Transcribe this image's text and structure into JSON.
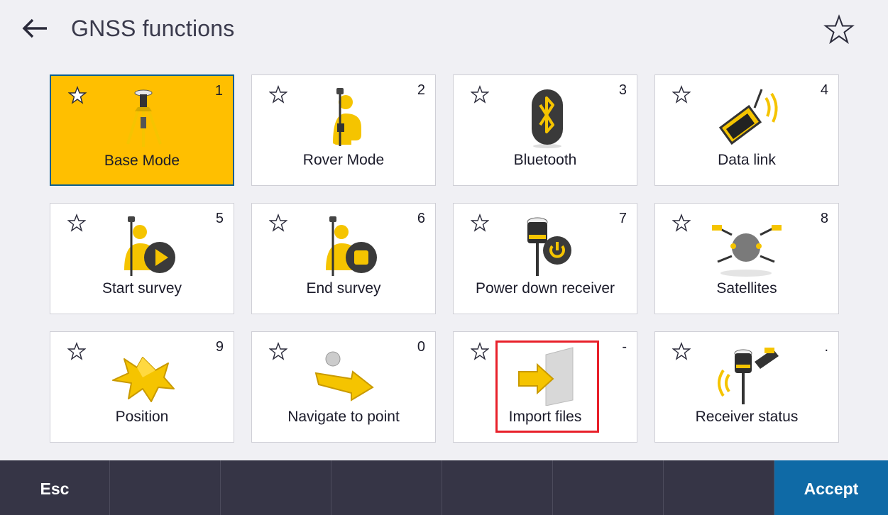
{
  "header": {
    "title": "GNSS functions",
    "back_icon": "arrow-left-icon",
    "favorite_icon": "star-outline-icon"
  },
  "tiles": [
    {
      "label": "Base Mode",
      "key": "1",
      "icon": "tripod-base-icon",
      "selected": true
    },
    {
      "label": "Rover Mode",
      "key": "2",
      "icon": "rover-person-icon",
      "selected": false
    },
    {
      "label": "Bluetooth",
      "key": "3",
      "icon": "bluetooth-icon",
      "selected": false
    },
    {
      "label": "Data link",
      "key": "4",
      "icon": "radio-data-link-icon",
      "selected": false
    },
    {
      "label": "Start survey",
      "key": "5",
      "icon": "start-survey-icon",
      "selected": false
    },
    {
      "label": "End survey",
      "key": "6",
      "icon": "end-survey-icon",
      "selected": false
    },
    {
      "label": "Power down receiver",
      "key": "7",
      "icon": "power-receiver-icon",
      "selected": false
    },
    {
      "label": "Satellites",
      "key": "8",
      "icon": "satellite-icon",
      "selected": false
    },
    {
      "label": "Position",
      "key": "9",
      "icon": "position-arrows-icon",
      "selected": false
    },
    {
      "label": "Navigate to point",
      "key": "0",
      "icon": "navigate-arrow-icon",
      "selected": false
    },
    {
      "label": "Import files",
      "key": "-",
      "icon": "import-file-icon",
      "selected": false
    },
    {
      "label": "Receiver status",
      "key": ".",
      "icon": "receiver-status-icon",
      "selected": false
    }
  ],
  "footer": {
    "esc_label": "Esc",
    "accept_label": "Accept"
  },
  "colors": {
    "selected_tile": "#ffbf00",
    "selected_border": "#0b5f8f",
    "footer_bg": "#363546",
    "accept_bg": "#0f6aa6",
    "highlight": "#e8202a",
    "icon_yellow": "#f5c400"
  }
}
